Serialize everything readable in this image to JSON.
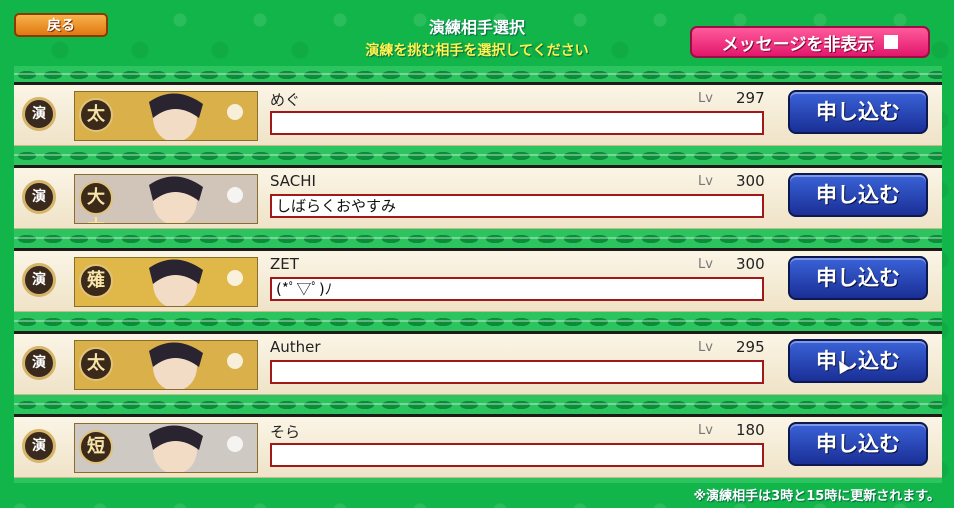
{
  "header": {
    "back_label": "戻る",
    "title": "演練相手選択",
    "subtitle": "演練を挑む相手を選択してください",
    "hide_messages_label": "メッセージを非表示"
  },
  "row_badge": "演",
  "apply_label": "申し込む",
  "lv_label": "Lv",
  "opponents": [
    {
      "name": "めぐ",
      "level": "297",
      "message": "",
      "sword_type": "太",
      "portrait_color": "#d9b04a"
    },
    {
      "name": "SACHI",
      "level": "300",
      "message": "しばらくおやすみ",
      "sword_type": "大太",
      "portrait_color": "#d0c5b8"
    },
    {
      "name": "ZET",
      "level": "300",
      "message": "(*ﾟ▽ﾟ)ﾉ",
      "sword_type": "薙",
      "portrait_color": "#e0b84a"
    },
    {
      "name": "Auther",
      "level": "295",
      "message": "",
      "sword_type": "太",
      "portrait_color": "#d9b04a"
    },
    {
      "name": "そら",
      "level": "180",
      "message": "",
      "sword_type": "短",
      "portrait_color": "#cfc9c3"
    }
  ],
  "footer_note": "※演練相手は3時と15時に更新されます。",
  "colors": {
    "background": "#12b54a",
    "apply_button": "#1a2f96",
    "message_border": "#a01818",
    "hide_button": "#e2176c",
    "back_button": "#e07812"
  }
}
